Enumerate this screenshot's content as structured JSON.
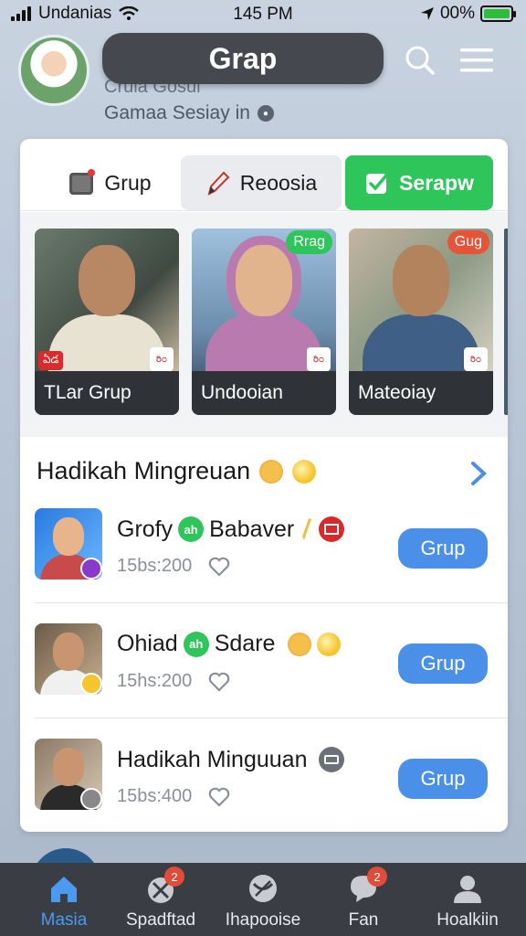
{
  "status_bar": {
    "carrier": "Undanias",
    "time": "145 PM",
    "battery": "00%"
  },
  "header": {
    "title": "Grap",
    "faded_text": "Crula Gosul",
    "subtitle": "Gamaa Sesiay in"
  },
  "tabs": [
    {
      "label": "Grup",
      "icon": "group-box-icon"
    },
    {
      "label": "Reoosia",
      "icon": "pencil-icon"
    },
    {
      "label": "Serapw",
      "icon": "check-icon"
    }
  ],
  "groups": [
    {
      "label": "TLar Grup",
      "flag": "ఏడ",
      "mini": "ರಿ೦"
    },
    {
      "label": "Undooian",
      "badge": "Rrag",
      "badge_color": "#2ec55a",
      "mini": "ರಿ೦"
    },
    {
      "label": "Mateoiay",
      "badge": "Gug",
      "badge_color": "#e55437",
      "mini": "ರಿ೦"
    }
  ],
  "section": {
    "title": "Hadikah Mingreuan"
  },
  "rows": [
    {
      "name_a": "Grofy",
      "pill": "ah",
      "name_b": "Babaver",
      "meta": "15bs:200",
      "button": "Grup"
    },
    {
      "name_a": "Ohiad",
      "pill": "ah",
      "name_b": "Sdare",
      "meta": "15hs:200",
      "button": "Grup"
    },
    {
      "name_a": "Hadikah Minguuan",
      "pill": "",
      "name_b": "",
      "meta": "15bs:400",
      "button": "Grup"
    }
  ],
  "nav": [
    {
      "label": "Masia",
      "icon": "home-icon",
      "active": true
    },
    {
      "label": "Spadftad",
      "icon": "satellite-icon",
      "count": "2"
    },
    {
      "label": "Ihapooise",
      "icon": "globe-icon"
    },
    {
      "label": "Fan",
      "icon": "chat-icon",
      "count": "2"
    },
    {
      "label": "Hoalkiin",
      "icon": "person-icon"
    }
  ],
  "colors": {
    "accent_blue": "#4a8fe8",
    "accent_green": "#2ec55a",
    "nav_bg": "#3a3d43"
  }
}
